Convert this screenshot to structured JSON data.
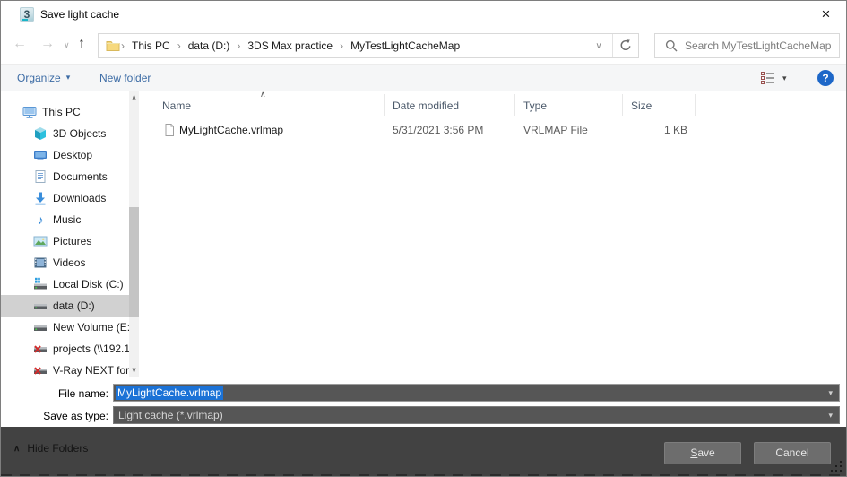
{
  "window": {
    "title": "Save light cache"
  },
  "icons": {
    "app_logo": "3",
    "close": "×",
    "back": "←",
    "forward": "→",
    "up": "↑",
    "dropdown": "▾",
    "chevron_down": "∨",
    "chevron_up": "∧",
    "breadcrumb_separator": "›",
    "music_note": "♪",
    "help": "?"
  },
  "nav": {
    "breadcrumb": [
      "This PC",
      "data (D:)",
      "3DS Max practice",
      "MyTestLightCacheMap"
    ],
    "search_placeholder": "Search MyTestLightCacheMap"
  },
  "toolbar": {
    "organize_label": "Organize",
    "new_folder_label": "New folder"
  },
  "sidebar": {
    "items": [
      {
        "label": "This PC",
        "selected": false
      },
      {
        "label": "3D Objects",
        "selected": false
      },
      {
        "label": "Desktop",
        "selected": false
      },
      {
        "label": "Documents",
        "selected": false
      },
      {
        "label": "Downloads",
        "selected": false
      },
      {
        "label": "Music",
        "selected": false
      },
      {
        "label": "Pictures",
        "selected": false
      },
      {
        "label": "Videos",
        "selected": false
      },
      {
        "label": "Local Disk (C:)",
        "selected": false
      },
      {
        "label": "data (D:)",
        "selected": true
      },
      {
        "label": "New Volume (E:)",
        "selected": false
      },
      {
        "label": "projects (\\\\192.1",
        "selected": false
      },
      {
        "label": "V-Ray NEXT for",
        "selected": false
      }
    ]
  },
  "filelist": {
    "columns": [
      "Name",
      "Date modified",
      "Type",
      "Size"
    ],
    "rows": [
      {
        "name": "MyLightCache.vrlmap",
        "date_modified": "5/31/2021 3:56 PM",
        "type": "VRLMAP File",
        "size": "1 KB"
      }
    ]
  },
  "footer": {
    "file_name_label": "File name:",
    "file_name_value": "MyLightCache.vrlmap",
    "save_as_type_label": "Save as type:",
    "save_as_type_value": "Light cache (*.vrlmap)"
  },
  "actions": {
    "hide_folders_label": "Hide Folders",
    "save_label": "Save",
    "cancel_label": "Cancel"
  },
  "colors": {
    "selection_blue": "#1b72d6",
    "toolbar_text_blue": "#3d6ca5",
    "dark_bar": "#424242",
    "field_bg": "#565656",
    "help_blue": "#1d67c8"
  }
}
